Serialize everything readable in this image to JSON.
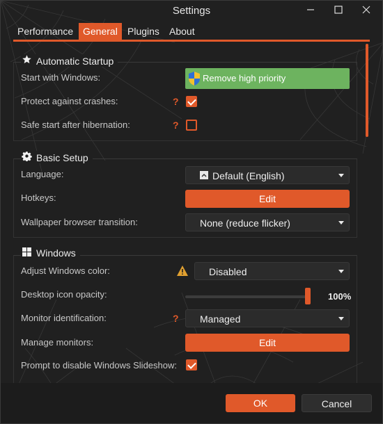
{
  "window": {
    "title": "Settings",
    "min_icon": "minimize-icon",
    "max_icon": "maximize-icon",
    "close_icon": "close-icon"
  },
  "tabs": [
    {
      "label": "Performance",
      "active": false
    },
    {
      "label": "General",
      "active": true
    },
    {
      "label": "Plugins",
      "active": false
    },
    {
      "label": "About",
      "active": false
    }
  ],
  "colors": {
    "accent": "#e0592a",
    "success": "#6db35f",
    "background": "#202020"
  },
  "startup": {
    "title": "Automatic Startup",
    "icon": "star-icon",
    "start_with_windows": {
      "label": "Start with Windows:",
      "button": "Remove high priority"
    },
    "protect_crashes": {
      "label": "Protect against crashes:",
      "help": "?",
      "checked": true
    },
    "safe_start": {
      "label": "Safe start after hibernation:",
      "help": "?",
      "checked": false
    }
  },
  "basic": {
    "title": "Basic Setup",
    "icon": "gear-icon",
    "language": {
      "label": "Language:",
      "value": "Default (English)"
    },
    "hotkeys": {
      "label": "Hotkeys:",
      "button": "Edit"
    },
    "wallpaper_transition": {
      "label": "Wallpaper browser transition:",
      "value": "None (reduce flicker)"
    }
  },
  "windows": {
    "title": "Windows",
    "icon": "windows-logo-icon",
    "adjust_color": {
      "label": "Adjust Windows color:",
      "value": "Disabled"
    },
    "icon_opacity": {
      "label": "Desktop icon opacity:",
      "value": "100%",
      "level": 1.0
    },
    "monitor_id": {
      "label": "Monitor identification:",
      "help": "?",
      "value": "Managed"
    },
    "manage_monitors": {
      "label": "Manage monitors:",
      "button": "Edit"
    },
    "prompt_slideshow": {
      "label": "Prompt to disable Windows Slideshow:",
      "checked": true
    }
  },
  "footer": {
    "ok": "OK",
    "cancel": "Cancel"
  }
}
